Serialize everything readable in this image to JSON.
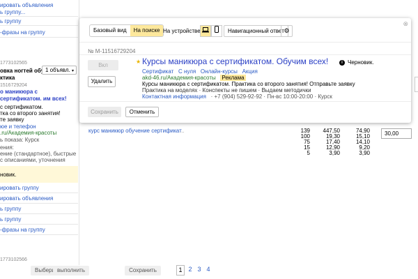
{
  "left_panel": {
    "top_links": [
      "ировать объявления",
      "ь группу...",
      "ь группу",
      "-фразы на группу"
    ],
    "group2_id": "1773102565",
    "group2_name": "овка ногтей обучение",
    "group2_subname": "ктика",
    "ad_groups_button": "1 объявл.",
    "ad_id_fragment": "1516729204",
    "ad_title_fragment": "о маникюра с сертификатом. им всех!",
    "ad_line1": "с сертификатом.",
    "ad_line2": "тка со второго занятия!",
    "ad_line3": "те заявку",
    "quick_link": "юе и телефон",
    "display_url": ".ru/Академия-красоты",
    "region": "ь показа: Курск",
    "strategy_label": "ения:",
    "strategy_line1": "ение (стандартное), быстрые",
    "strategy_line2": "с описаниями, уточнения",
    "status_text": "новик.",
    "bottom_links": [
      "ировать группу",
      "ировать объявления",
      "ь группу",
      "ь группу",
      "-фразы на группу"
    ],
    "group3_id": "1773102566"
  },
  "keywords": {
    "phrase": "курс маникюр обучение сертификат",
    "more": "...",
    "col1": [
      "139",
      "100",
      "75",
      "15",
      "5"
    ],
    "col2": [
      "447,50",
      "19,30",
      "17,40",
      "12,90",
      "3,90"
    ],
    "col3": [
      "74,90",
      "15,10",
      "14,10",
      "9,20",
      "3,90"
    ],
    "bid_value": "30,00"
  },
  "bottom_bar": {
    "select_label": "Выберите",
    "apply_label": "выполнить",
    "save_label": "Сохранить",
    "pages": [
      "1",
      "2",
      "3",
      "4"
    ]
  },
  "modal": {
    "tabs": [
      "Базовый вид",
      "На поиске"
    ],
    "device_label": "На устройстве",
    "nav_answer": "Навигационный ответ",
    "ad_id": "№ M-11516729204",
    "gray_button": "Вкл",
    "delete_button": "Удалить",
    "ad": {
      "title": "Курсы маникюра с сертификатом. Обучим всех!",
      "sitelinks": [
        "Сертификат",
        "С нуля",
        "Онлайн-курсы",
        "Акция"
      ],
      "url": "akd-46.ru/Академия-красоты",
      "ad_badge": "Реклама",
      "text": "Курсы маникюра с сертификатом. Практика со второго занятия! Отправьте заявку",
      "callouts": "Практика на моделях · Конспекты не пишем · Выдаем методички",
      "contact_label": "Контактная информация",
      "contact_details": "· +7 (904) 529-92-92 · Пн-вс 10:00-20:00 · Курск"
    },
    "status": "Черновик.",
    "save_button": "Сохранить",
    "cancel_button": "Отменить"
  },
  "icons": {
    "laptop": "laptop-icon",
    "phone": "mobile-phone-icon",
    "gear": "gear-icon",
    "info": "info-icon",
    "star": "star-icon",
    "close": "close-icon"
  }
}
